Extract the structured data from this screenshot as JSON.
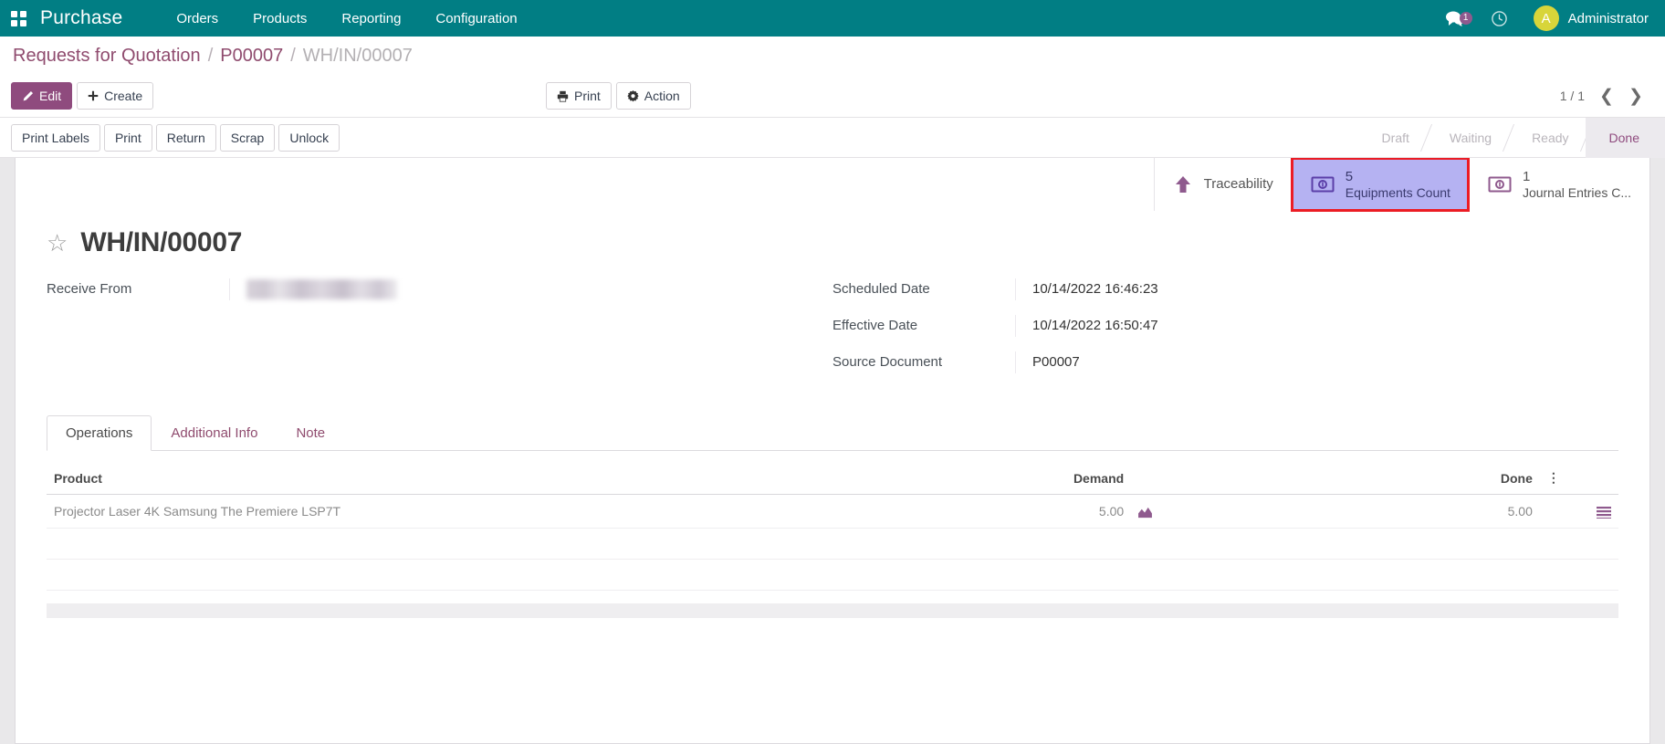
{
  "navbar": {
    "apps_icon": "apps-grid-icon",
    "brand": "Purchase",
    "menu": [
      {
        "label": "Orders"
      },
      {
        "label": "Products"
      },
      {
        "label": "Reporting"
      },
      {
        "label": "Configuration"
      }
    ],
    "messages_icon": "messages-icon",
    "messages_badge": "1",
    "activity_icon": "clock-icon",
    "user_initial": "A",
    "user_name": "Administrator",
    "bg_color": "#017e84"
  },
  "breadcrumb": {
    "root": "Requests for Quotation",
    "separator": "/",
    "parent": "P00007",
    "current": "WH/IN/00007"
  },
  "controls": {
    "edit_label": "Edit",
    "edit_icon": "pencil-icon",
    "create_label": "Create",
    "create_icon": "plus-icon",
    "print_label": "Print",
    "print_icon": "printer-icon",
    "action_label": "Action",
    "action_icon": "gear-icon",
    "pager_count": "1 / 1",
    "prev_icon": "chevron-left-icon",
    "next_icon": "chevron-right-icon"
  },
  "statusbar": {
    "buttons": [
      {
        "label": "Print Labels"
      },
      {
        "label": "Print"
      },
      {
        "label": "Return"
      },
      {
        "label": "Scrap"
      },
      {
        "label": "Unlock"
      }
    ],
    "stages": [
      {
        "label": "Draft",
        "active": false
      },
      {
        "label": "Waiting",
        "active": false
      },
      {
        "label": "Ready",
        "active": false
      },
      {
        "label": "Done",
        "active": true
      }
    ],
    "active_color": "#8f4b7e"
  },
  "stat_buttons": [
    {
      "icon": "up-arrow-icon",
      "value": "",
      "label": "Traceability",
      "highlighted": false
    },
    {
      "icon": "money-bill-icon",
      "value": "5",
      "label": "Equipments Count",
      "highlighted": true
    },
    {
      "icon": "money-bill-icon",
      "value": "1",
      "label": "Journal Entries C...",
      "highlighted": false
    }
  ],
  "highlight_color": "#ec1c24",
  "record": {
    "star_icon": "star-outline-icon",
    "title": "WH/IN/00007",
    "left_fields": [
      {
        "label": "Receive From",
        "value": "",
        "redacted": true
      }
    ],
    "right_fields": [
      {
        "label": "Scheduled Date",
        "value": "10/14/2022 16:46:23"
      },
      {
        "label": "Effective Date",
        "value": "10/14/2022 16:50:47"
      },
      {
        "label": "Source Document",
        "value": "P00007"
      }
    ]
  },
  "notebook": {
    "tabs": [
      {
        "label": "Operations",
        "active": true
      },
      {
        "label": "Additional Info",
        "active": false
      },
      {
        "label": "Note",
        "active": false
      }
    ]
  },
  "lines_table": {
    "columns": [
      {
        "label": "Product",
        "align": "left"
      },
      {
        "label": "Demand",
        "align": "right"
      },
      {
        "label": "",
        "align": "left"
      },
      {
        "label": "Done",
        "align": "right"
      }
    ],
    "options_icon": "vertical-dots-icon",
    "rows": [
      {
        "product": "Projector Laser 4K Samsung The Premiere LSP7T",
        "demand": "5.00",
        "demand_icon": "chart-area-icon",
        "done": "5.00",
        "done_icon": "list-icon"
      }
    ]
  }
}
